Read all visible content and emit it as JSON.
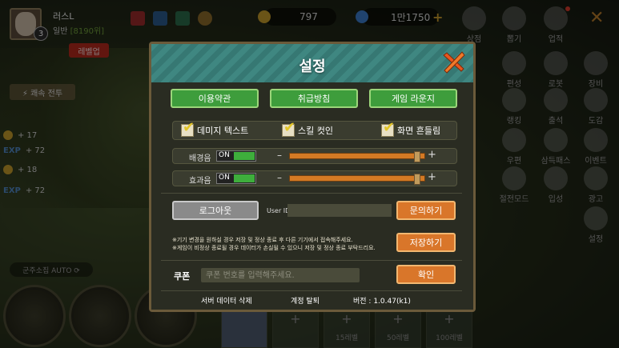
{
  "player": {
    "name": "러스L",
    "level": "3",
    "rank_label": "일반",
    "rank_value": "[8190위]",
    "levelup_label": "레벨업"
  },
  "currency": {
    "coins": "797",
    "gems": "1만1750"
  },
  "hud": {
    "auto_battle": "⚡ 쾌속 전투",
    "stats": [
      {
        "kind": "coin",
        "value": "+ 17"
      },
      {
        "kind": "exp",
        "label": "EXP",
        "value": "+ 72"
      },
      {
        "kind": "coin",
        "value": "+ 18"
      },
      {
        "kind": "exp",
        "label": "EXP",
        "value": "+ 72"
      }
    ],
    "auto_mode": "군주소집 AUTO ⟳"
  },
  "right_menu": [
    "상점",
    "뽑기",
    "업적",
    "편성",
    "로봇",
    "장비",
    "랭킹",
    "출석",
    "도감",
    "우편",
    "삼득패스",
    "이벤트",
    "절전모드",
    "입성",
    "광고",
    "설정"
  ],
  "slots": [
    "15레벨",
    "50레벨",
    "100레벨"
  ],
  "modal": {
    "title": "설정",
    "top_buttons": [
      "이용약관",
      "취급방침",
      "게임 라운지"
    ],
    "options": [
      {
        "label": "데미지 텍스트",
        "checked": true
      },
      {
        "label": "스킬 컷인",
        "checked": true
      },
      {
        "label": "화면 흔들림",
        "checked": true
      }
    ],
    "bgm": {
      "label": "배경음",
      "state": "ON",
      "level": 0.97
    },
    "sfx": {
      "label": "효과음",
      "state": "ON",
      "level": 0.97
    },
    "logout_label": "로그아웃",
    "user_id_label": "User ID",
    "user_id_value": "",
    "inquiry_label": "문의하기",
    "save_note_1": "※기기 변경을 원하실 경우 저장 및 정상 종료 후 다른 기기에서 접속해주세요.",
    "save_note_2": "※게임이 비정상 종료될 경우 데이터가 손실될 수 있으니 저장 및 정상 종료 부탁드리요.",
    "save_label": "저장하기",
    "coupon_label": "쿠폰",
    "coupon_placeholder": "쿠폰 번호를 입력해주세요.",
    "confirm_label": "확인",
    "footer": {
      "delete_data": "서버 데이터 삭제",
      "withdraw": "계정 탈퇴",
      "version": "버전 : 1.0.47(k1)"
    }
  },
  "colors": {
    "accent_green": "#3e9d3c",
    "accent_orange": "#d9762a",
    "header_teal": "#3f8781",
    "panel_tan": "#d8ba82"
  }
}
